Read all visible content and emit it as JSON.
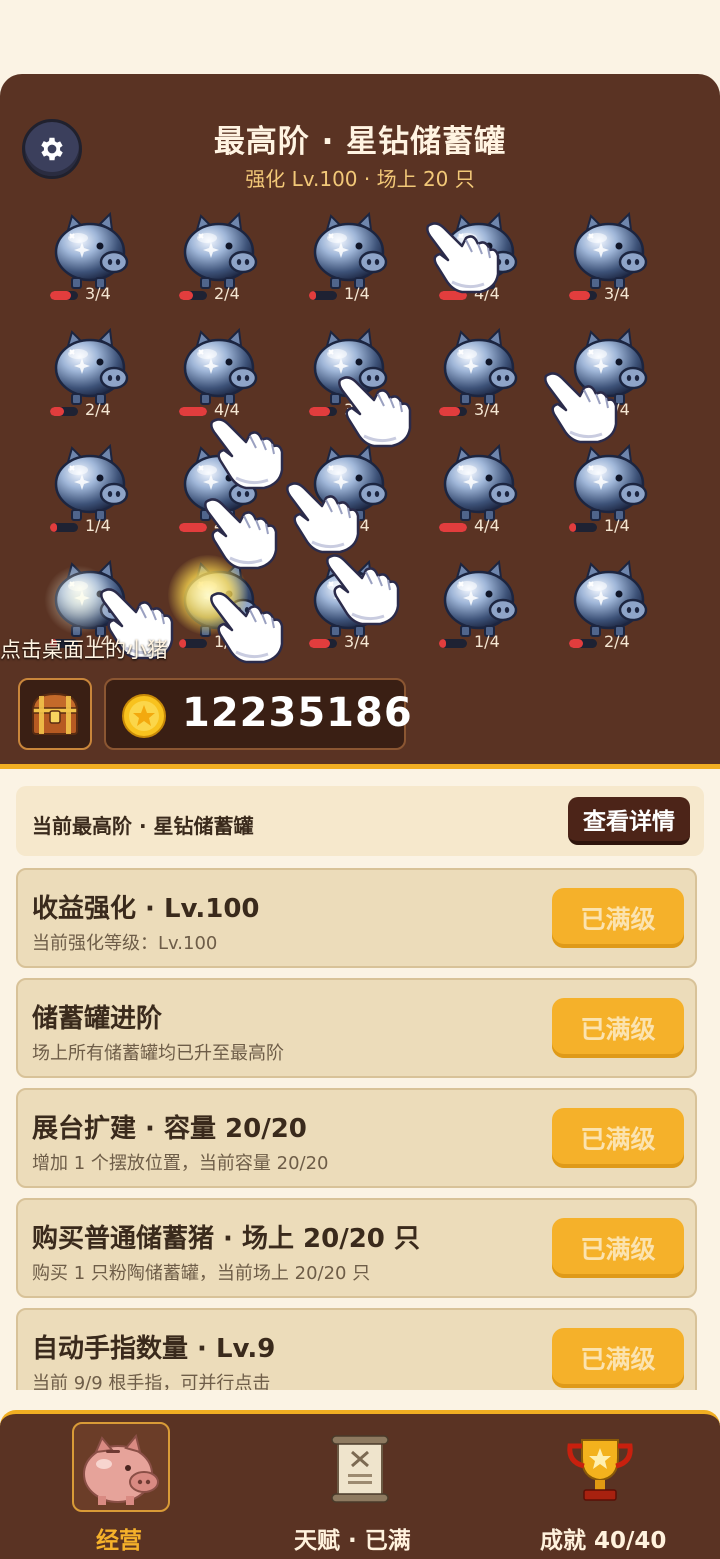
{
  "header": {
    "title": "最高阶 · 星钻储蓄罐",
    "subtitle": "强化 Lv.100 · 场上 20 只"
  },
  "pigs": [
    {
      "count": "3/4",
      "fill": 0.75
    },
    {
      "count": "2/4",
      "fill": 0.5
    },
    {
      "count": "1/4",
      "fill": 0.25
    },
    {
      "count": "4/4",
      "fill": 1.0
    },
    {
      "count": "3/4",
      "fill": 0.75
    },
    {
      "count": "2/4",
      "fill": 0.5
    },
    {
      "count": "4/4",
      "fill": 1.0
    },
    {
      "count": "3/4",
      "fill": 0.75
    },
    {
      "count": "3/4",
      "fill": 0.75
    },
    {
      "count": "2/4",
      "fill": 0.5
    },
    {
      "count": "1/4",
      "fill": 0.25
    },
    {
      "count": "4/4",
      "fill": 1.0
    },
    {
      "count": "4/4",
      "fill": 1.0
    },
    {
      "count": "4/4",
      "fill": 1.0
    },
    {
      "count": "1/4",
      "fill": 0.25
    },
    {
      "count": "1/4",
      "fill": 0.25
    },
    {
      "count": "1/4",
      "fill": 0.25
    },
    {
      "count": "3/4",
      "fill": 0.75
    },
    {
      "count": "1/4",
      "fill": 0.25
    },
    {
      "count": "2/4",
      "fill": 0.5
    }
  ],
  "hint": "点击桌面上的小猪",
  "coins": "12235186",
  "detail": {
    "label": "当前最高阶 · 星钻储蓄罐",
    "button": "查看详情"
  },
  "upgrades": [
    {
      "title": "收益强化 · Lv.100",
      "desc": "当前强化等级：Lv.100",
      "button": "已满级"
    },
    {
      "title": "储蓄罐进阶",
      "desc": "场上所有储蓄罐均已升至最高阶",
      "button": "已满级"
    },
    {
      "title": "展台扩建 · 容量 20/20",
      "desc": "增加 1 个摆放位置，当前容量 20/20",
      "button": "已满级"
    },
    {
      "title": "购买普通储蓄猪 · 场上 20/20 只",
      "desc": "购买 1 只粉陶储蓄罐，当前场上 20/20 只",
      "button": "已满级"
    },
    {
      "title": "自动手指数量 · Lv.9",
      "desc": "当前 9/9 根手指，可并行点击",
      "button": "已满级"
    }
  ],
  "nav": {
    "items": [
      {
        "label": "经营",
        "icon": "pig-icon",
        "active": true
      },
      {
        "label": "天赋 · 已满",
        "icon": "scroll-icon",
        "active": false
      },
      {
        "label": "成就 40/40",
        "icon": "trophy-icon",
        "active": false
      }
    ],
    "active_color": "#f5b12a"
  },
  "colors": {
    "board": "#5a3323",
    "accent": "#f1ae22",
    "button_max": "#f5b12a",
    "bar_fill": "#e23d3d"
  }
}
